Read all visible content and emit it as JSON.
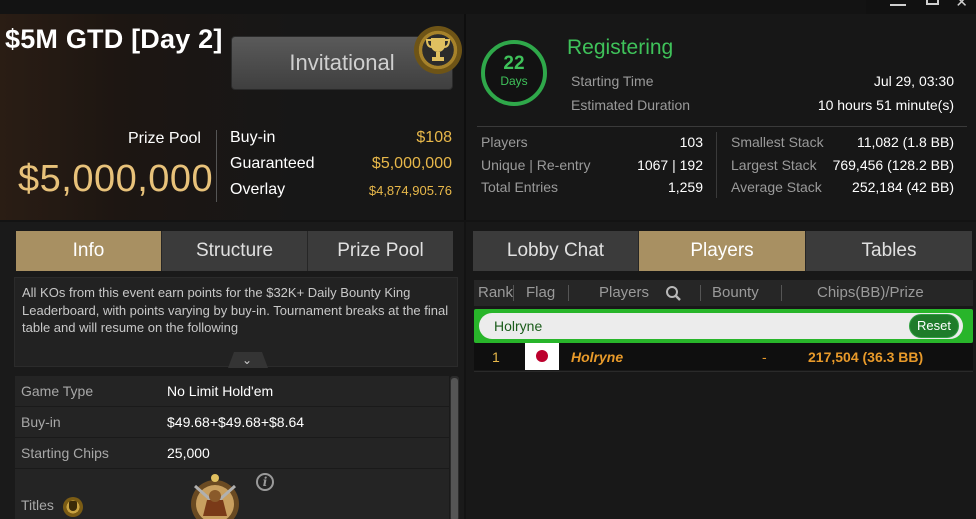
{
  "window": {
    "minimize": "minimize",
    "maximize": "maximize",
    "close": "✕"
  },
  "tournament": {
    "title": "$5M GTD [Day 2]",
    "invitational_label": "Invitational",
    "prize_pool_label": "Prize Pool",
    "prize_pool_value": "$5,000,000",
    "buyin_label": "Buy-in",
    "buyin_value": "$108",
    "guaranteed_label": "Guaranteed",
    "guaranteed_value": "$5,000,000",
    "overlay_label": "Overlay",
    "overlay_value": "$4,874,905.76"
  },
  "status": {
    "days_value": "22",
    "days_label": "Days",
    "state": "Registering",
    "starting_time_label": "Starting Time",
    "starting_time_value": "Jul 29, 03:30",
    "duration_label": "Estimated Duration",
    "duration_value": "10 hours 51 minute(s)"
  },
  "stats": {
    "players_label": "Players",
    "players_value": "103",
    "unique_label": "Unique | Re-entry",
    "unique_value": "1067 | 192",
    "total_label": "Total Entries",
    "total_value": "1,259",
    "smallest_label": "Smallest Stack",
    "smallest_value": "11,082 (1.8 BB)",
    "largest_label": "Largest Stack",
    "largest_value": "769,456 (128.2 BB)",
    "average_label": "Average Stack",
    "average_value": "252,184 (42 BB)"
  },
  "left_tabs": [
    "Info",
    "Structure",
    "Prize Pool"
  ],
  "description": "All KOs from this event earn points for the $32K+ Daily Bounty King Leaderboard, with points varying by buy-in. Tournament breaks at the final table and will resume on the following",
  "details": {
    "game_type_label": "Game Type",
    "game_type_value": "No Limit Hold'em",
    "buyin_label": "Buy-in",
    "buyin_value": "$49.68+$49.68+$8.64",
    "chips_label": "Starting Chips",
    "chips_value": "25,000",
    "titles_label": "Titles"
  },
  "right_tabs": [
    "Lobby Chat",
    "Players",
    "Tables"
  ],
  "grid": {
    "headers": [
      "Rank",
      "Flag",
      "Players",
      "Bounty",
      "Chips(BB)/Prize"
    ],
    "filter_value": "Holryne",
    "reset_label": "Reset",
    "rows": [
      {
        "rank": "1",
        "flag": "japan-flag",
        "name": "Holryne",
        "bounty": "-",
        "chips": "217,504 (36.3 BB)"
      }
    ]
  },
  "colors": {
    "gold": "#e8b84a",
    "tab_active": "#a89062",
    "green": "#3fc25a",
    "filter_green": "#28b52a",
    "player_orange": "#e89a2a"
  }
}
